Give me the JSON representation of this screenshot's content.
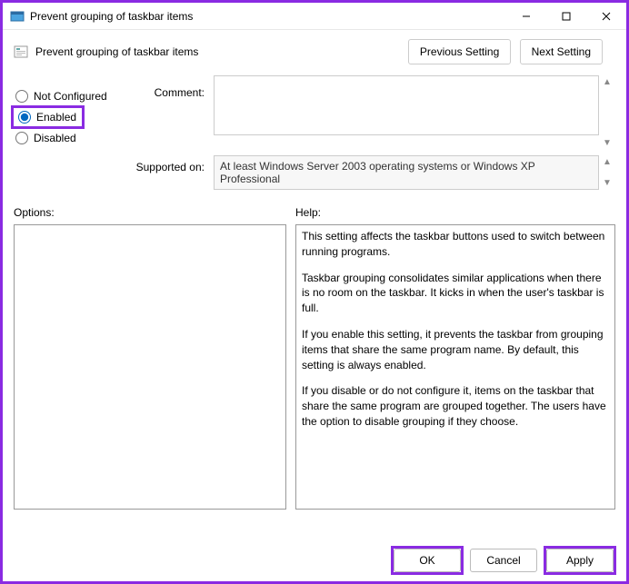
{
  "window": {
    "title": "Prevent grouping of taskbar items"
  },
  "subheader": {
    "title": "Prevent grouping of taskbar items"
  },
  "nav": {
    "previous": "Previous Setting",
    "next": "Next Setting"
  },
  "state": {
    "options": [
      {
        "label": "Not Configured",
        "checked": false
      },
      {
        "label": "Enabled",
        "checked": true
      },
      {
        "label": "Disabled",
        "checked": false
      }
    ]
  },
  "comment": {
    "label": "Comment:",
    "value": ""
  },
  "supported": {
    "label": "Supported on:",
    "value": "At least Windows Server 2003 operating systems or Windows XP Professional"
  },
  "sections": {
    "options_label": "Options:",
    "help_label": "Help:"
  },
  "options_panel": "",
  "help_panel": [
    "This setting affects the taskbar buttons used to switch between running programs.",
    "Taskbar grouping consolidates similar applications when there is no room on the taskbar. It kicks in when the user's taskbar is full.",
    "If you enable this setting, it prevents the taskbar from grouping items that share the same program name. By default, this setting is always enabled.",
    "If you disable or do not configure it, items on the taskbar that share the same program are grouped together. The users have the option to disable grouping if they choose."
  ],
  "footer": {
    "ok": "OK",
    "cancel": "Cancel",
    "apply": "Apply"
  }
}
